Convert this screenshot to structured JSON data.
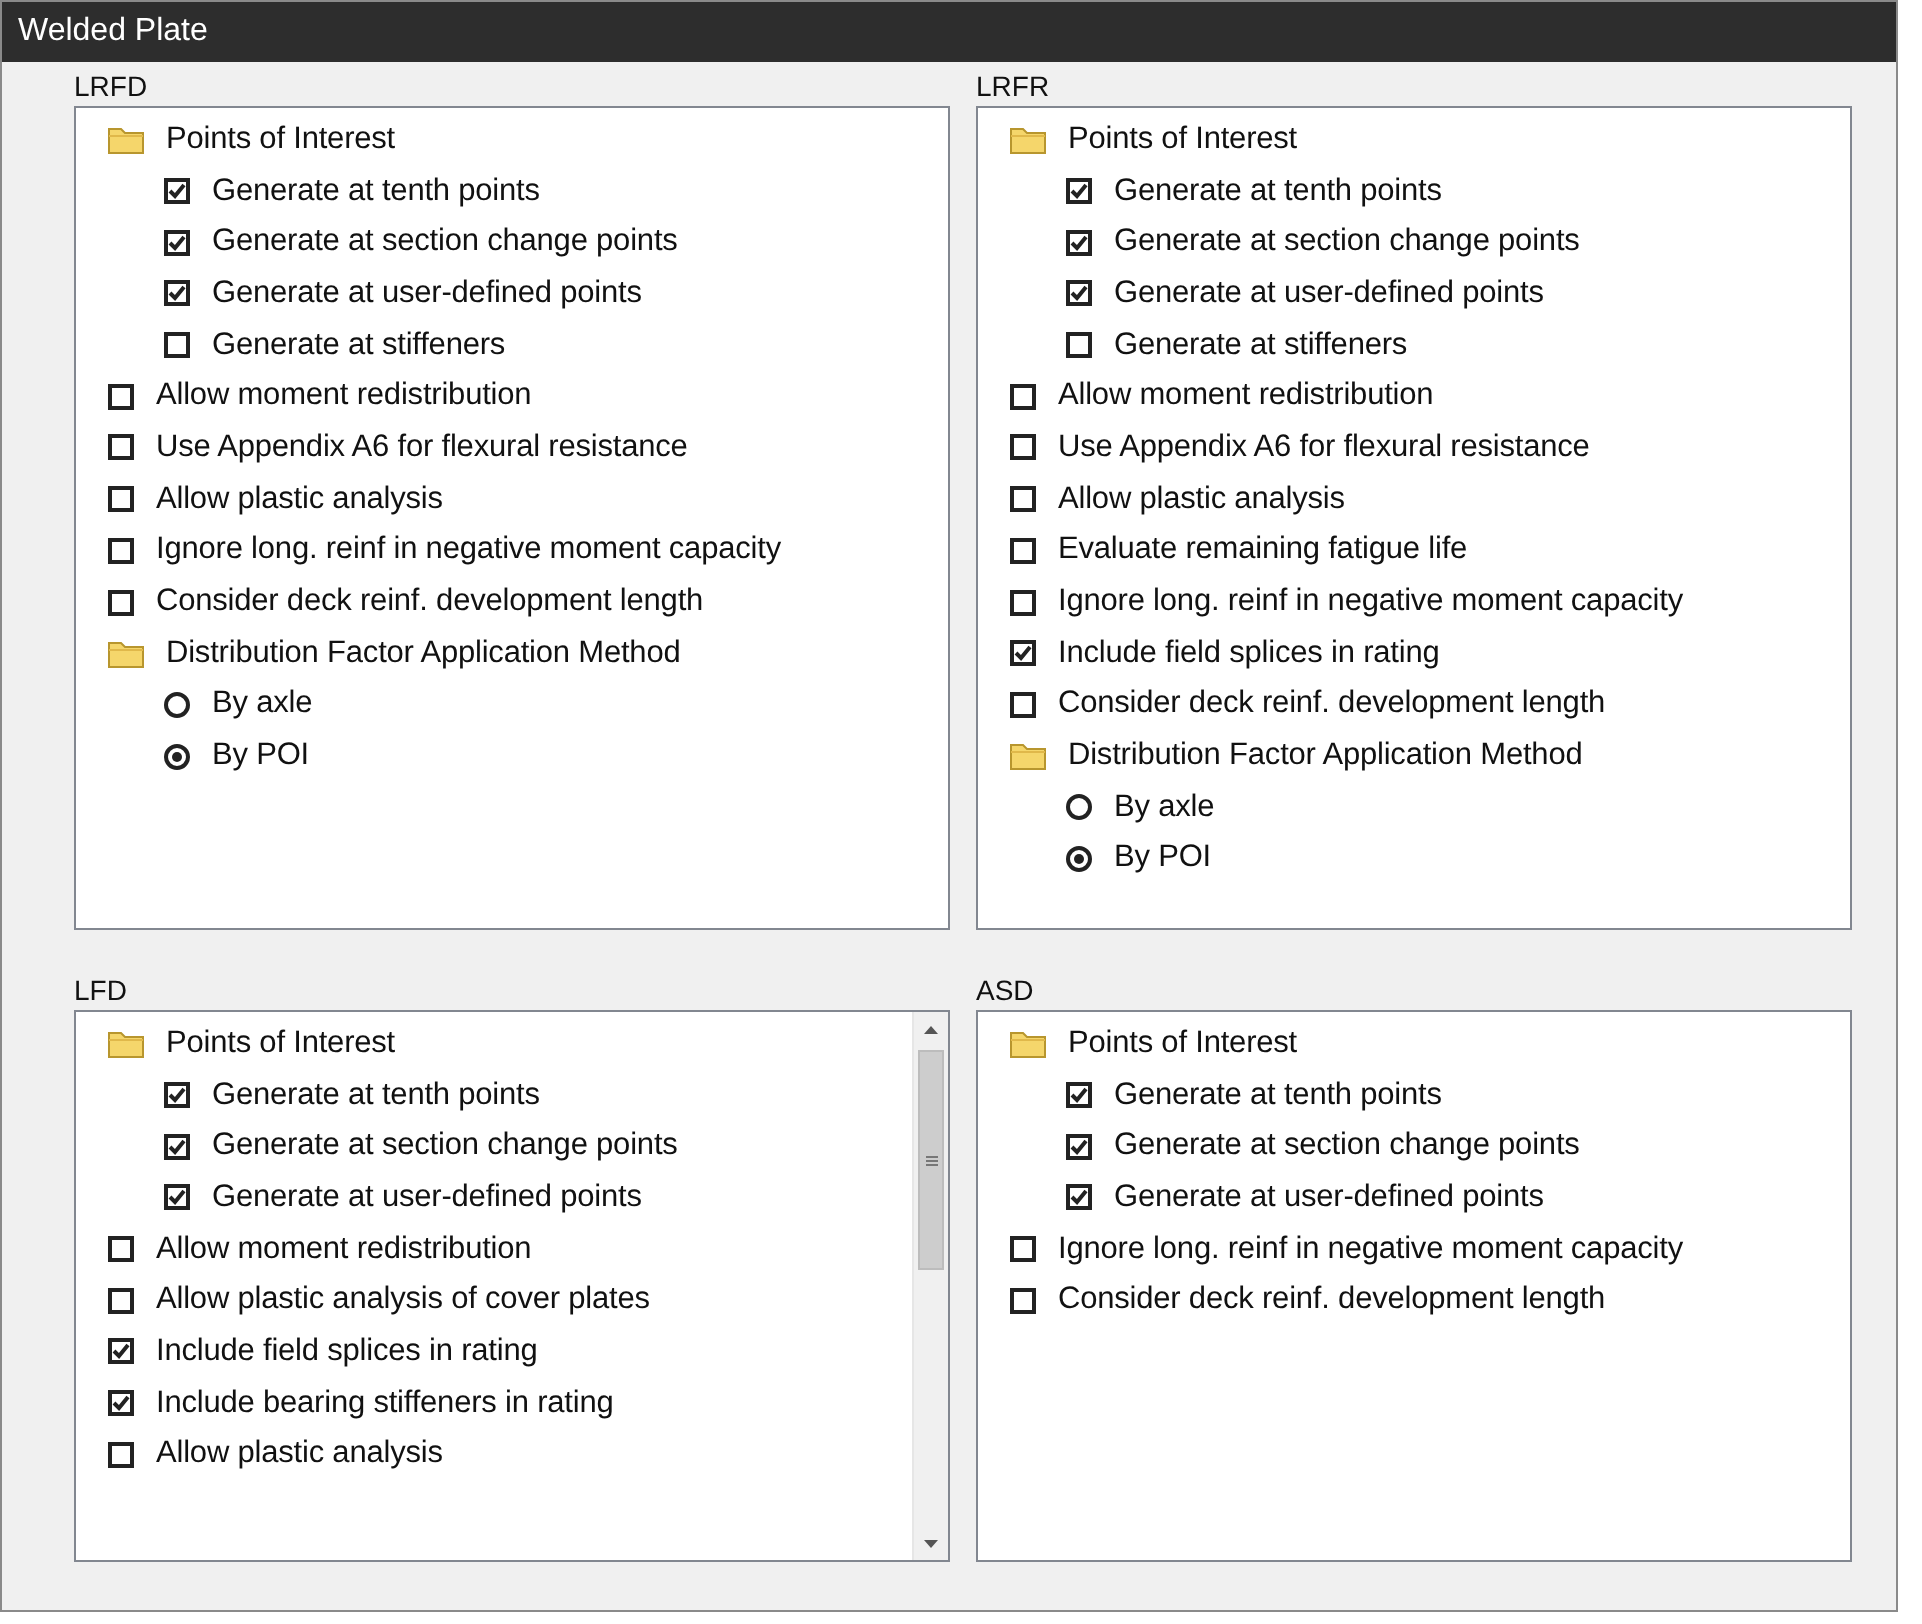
{
  "window": {
    "title": "Welded Plate"
  },
  "panels": [
    {
      "title": "LRFD",
      "scrollable": false,
      "items": [
        {
          "kind": "folder",
          "label": "Points of Interest",
          "children": [
            {
              "kind": "checkbox",
              "label": "Generate at tenth points",
              "checked": true
            },
            {
              "kind": "checkbox",
              "label": "Generate at section change points",
              "checked": true
            },
            {
              "kind": "checkbox",
              "label": "Generate at user-defined points",
              "checked": true
            },
            {
              "kind": "checkbox",
              "label": "Generate at stiffeners",
              "checked": false
            }
          ]
        },
        {
          "kind": "checkbox",
          "label": "Allow moment redistribution",
          "checked": false
        },
        {
          "kind": "checkbox",
          "label": "Use Appendix A6 for flexural resistance",
          "checked": false
        },
        {
          "kind": "checkbox",
          "label": "Allow plastic analysis",
          "checked": false
        },
        {
          "kind": "checkbox",
          "label": "Ignore long. reinf in negative moment capacity",
          "checked": false
        },
        {
          "kind": "checkbox",
          "label": "Consider deck reinf. development length",
          "checked": false
        },
        {
          "kind": "folder",
          "label": "Distribution Factor Application Method",
          "children": [
            {
              "kind": "radio",
              "label": "By axle",
              "selected": false
            },
            {
              "kind": "radio",
              "label": "By POI",
              "selected": true
            }
          ]
        }
      ]
    },
    {
      "title": "LRFR",
      "scrollable": false,
      "items": [
        {
          "kind": "folder",
          "label": "Points of Interest",
          "children": [
            {
              "kind": "checkbox",
              "label": "Generate at tenth points",
              "checked": true
            },
            {
              "kind": "checkbox",
              "label": "Generate at section change points",
              "checked": true
            },
            {
              "kind": "checkbox",
              "label": "Generate at user-defined points",
              "checked": true
            },
            {
              "kind": "checkbox",
              "label": "Generate at stiffeners",
              "checked": false
            }
          ]
        },
        {
          "kind": "checkbox",
          "label": "Allow moment redistribution",
          "checked": false
        },
        {
          "kind": "checkbox",
          "label": "Use Appendix A6 for flexural resistance",
          "checked": false
        },
        {
          "kind": "checkbox",
          "label": "Allow plastic analysis",
          "checked": false
        },
        {
          "kind": "checkbox",
          "label": "Evaluate remaining fatigue life",
          "checked": false
        },
        {
          "kind": "checkbox",
          "label": "Ignore long. reinf in negative moment capacity",
          "checked": false
        },
        {
          "kind": "checkbox",
          "label": "Include field splices in rating",
          "checked": true
        },
        {
          "kind": "checkbox",
          "label": "Consider deck reinf. development length",
          "checked": false
        },
        {
          "kind": "folder",
          "label": "Distribution Factor Application Method",
          "children": [
            {
              "kind": "radio",
              "label": "By axle",
              "selected": false
            },
            {
              "kind": "radio",
              "label": "By POI",
              "selected": true
            }
          ]
        }
      ]
    },
    {
      "title": "LFD",
      "scrollable": true,
      "items": [
        {
          "kind": "folder",
          "label": "Points of Interest",
          "children": [
            {
              "kind": "checkbox",
              "label": "Generate at tenth points",
              "checked": true
            },
            {
              "kind": "checkbox",
              "label": "Generate at section change points",
              "checked": true
            },
            {
              "kind": "checkbox",
              "label": "Generate at user-defined points",
              "checked": true
            }
          ]
        },
        {
          "kind": "checkbox",
          "label": "Allow moment redistribution",
          "checked": false
        },
        {
          "kind": "checkbox",
          "label": "Allow plastic analysis of cover plates",
          "checked": false
        },
        {
          "kind": "checkbox",
          "label": "Include field splices in rating",
          "checked": true
        },
        {
          "kind": "checkbox",
          "label": "Include bearing stiffeners in rating",
          "checked": true
        },
        {
          "kind": "checkbox",
          "label": "Allow plastic analysis",
          "checked": false
        }
      ]
    },
    {
      "title": "ASD",
      "scrollable": false,
      "items": [
        {
          "kind": "folder",
          "label": "Points of Interest",
          "children": [
            {
              "kind": "checkbox",
              "label": "Generate at tenth points",
              "checked": true
            },
            {
              "kind": "checkbox",
              "label": "Generate at section change points",
              "checked": true
            },
            {
              "kind": "checkbox",
              "label": "Generate at user-defined points",
              "checked": true
            }
          ]
        },
        {
          "kind": "checkbox",
          "label": "Ignore long. reinf in negative moment capacity",
          "checked": false
        },
        {
          "kind": "checkbox",
          "label": "Consider deck reinf. development length",
          "checked": false
        }
      ]
    }
  ]
}
